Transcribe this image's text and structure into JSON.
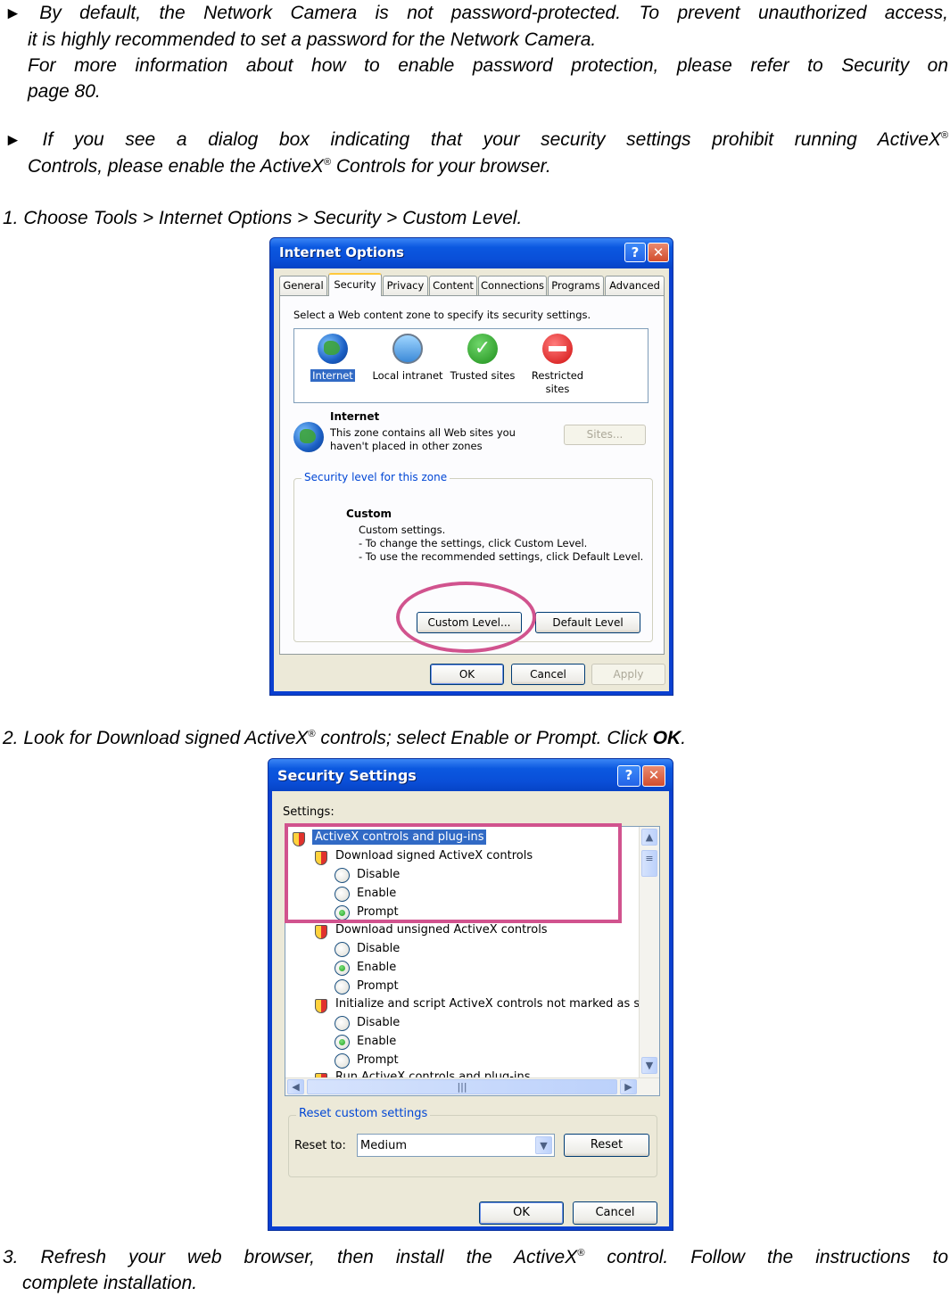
{
  "doc": {
    "bullet1_line1": "By default, the Network Camera is not password-protected. To prevent unauthorized access,",
    "bullet1_line2": "it is highly recommended to set a password for the Network Camera.",
    "bullet1_line3": "For more information about how to enable password protection, please refer to Security on",
    "bullet1_line4": "page 80.",
    "bullet2_line1a": "If you see a dialog box indicating that your security settings prohibit running ActiveX",
    "bullet2_line2a": "Controls, please enable the ActiveX",
    "bullet2_line2b": " Controls for your browser.",
    "registered": "®",
    "step1": "1. Choose Tools > Internet Options > Security > Custom Level.",
    "step2a": "2. Look for Download signed ActiveX",
    "step2b": " controls; select Enable or Prompt. Click ",
    "step2_ok": "OK",
    "step2_end": ".",
    "step3_line1a": "3. Refresh your web browser, then install the ActiveX",
    "step3_line1b": " control. Follow the instructions to",
    "step3_line2": "complete installation.",
    "bullet_glyph": "►"
  },
  "internet_options": {
    "title": "Internet Options",
    "help": "?",
    "close": "✕",
    "tabs": [
      "General",
      "Security",
      "Privacy",
      "Content",
      "Connections",
      "Programs",
      "Advanced"
    ],
    "active_tab": "Security",
    "zone_prompt": "Select a Web content zone to specify its security settings.",
    "zones": [
      "Internet",
      "Local intranet",
      "Trusted sites",
      "Restricted sites"
    ],
    "zone_heading": "Internet",
    "zone_desc_1": "This zone contains all Web sites you",
    "zone_desc_2": "haven't placed in other zones",
    "sites_btn": "Sites...",
    "level_group": "Security level for this zone",
    "level_name": "Custom",
    "level_l1": "Custom settings.",
    "level_l2": "- To change the settings, click Custom Level.",
    "level_l3": "- To use the recommended settings, click Default Level.",
    "custom_level_btn": "Custom Level...",
    "default_level_btn": "Default Level",
    "ok": "OK",
    "cancel": "Cancel",
    "apply": "Apply"
  },
  "security_settings": {
    "title": "Security Settings",
    "help": "?",
    "close": "✕",
    "settings_label": "Settings:",
    "list": {
      "category": "ActiveX controls and plug-ins",
      "g1": "Download signed ActiveX controls",
      "g2": "Download unsigned ActiveX controls",
      "g3": "Initialize and script ActiveX controls not marked as safe",
      "g4": "Run ActiveX controls and plug-ins",
      "opt_disable": "Disable",
      "opt_enable": "Enable",
      "opt_prompt": "Prompt"
    },
    "reset_group": "Reset custom settings",
    "reset_to": "Reset to:",
    "reset_value": "Medium",
    "reset_btn": "Reset",
    "ok": "OK",
    "cancel": "Cancel"
  },
  "colors": {
    "highlight": "#d1538e",
    "xp_title": "#0a4fd8",
    "xp_face": "#ece9d8"
  }
}
